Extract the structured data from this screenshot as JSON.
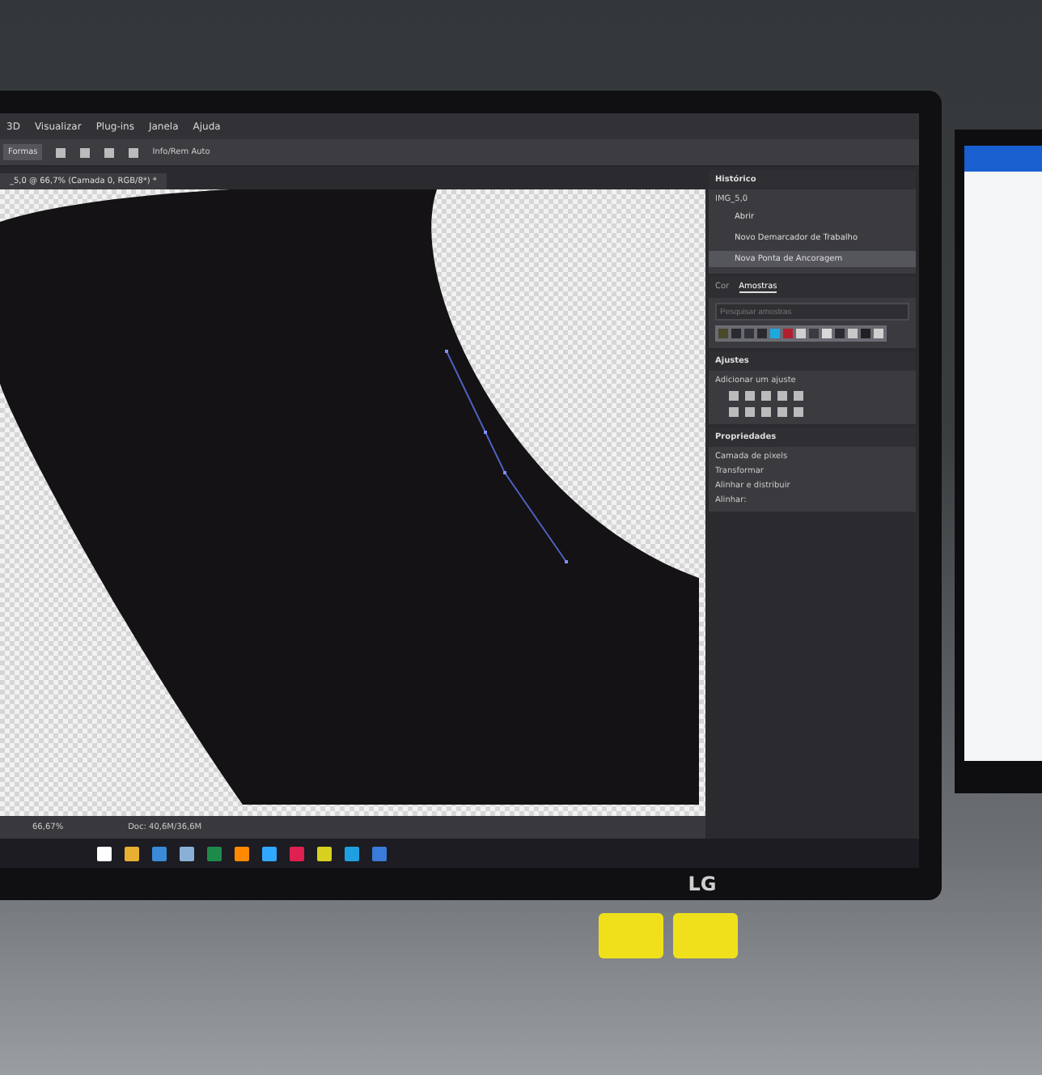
{
  "menu": [
    {
      "label": "3D"
    },
    {
      "label": "Visualizar"
    },
    {
      "label": "Plug-ins"
    },
    {
      "label": "Janela"
    },
    {
      "label": "Ajuda"
    }
  ],
  "options_bar": {
    "mode": "Formas",
    "auto_label": "Info/Rem Auto"
  },
  "document_tab": {
    "title": "_5,0 @ 66,7% (Camada 0, RGB/8*) *"
  },
  "history_panel": {
    "title": "Histórico",
    "snapshot": "IMG_5,0",
    "items": [
      {
        "label": "Abrir",
        "selected": false
      },
      {
        "label": "Novo Demarcador de Trabalho",
        "selected": false
      },
      {
        "label": "Nova Ponta de Ancoragem",
        "selected": true
      }
    ]
  },
  "swatches_panel": {
    "tabs": [
      {
        "label": "Cor",
        "selected": false
      },
      {
        "label": "Amostras",
        "selected": true
      }
    ],
    "search": {
      "placeholder": "Pesquisar amostras"
    },
    "swatches": [
      {
        "color": "#4a4a2a"
      },
      {
        "color": "#2a2a30"
      },
      {
        "color": "#33333a"
      },
      {
        "color": "#2a2a2e"
      },
      {
        "color": "#1ea8e0"
      },
      {
        "color": "#b02030"
      },
      {
        "color": "#d0d0d0"
      },
      {
        "color": "#3a3a40"
      },
      {
        "color": "#d8d8d8"
      },
      {
        "color": "#2a2a30"
      },
      {
        "color": "#c8c8c8"
      },
      {
        "color": "#202024"
      },
      {
        "color": "#d0d0d0"
      }
    ]
  },
  "adjustments_panel": {
    "title": "Ajustes",
    "hint": "Adicionar um ajuste"
  },
  "properties_panel": {
    "title": "Propriedades",
    "layer_type": "Camada de pixels",
    "transform_title": "Transformar",
    "align_title": "Alinhar e distribuir",
    "align_label": "Alinhar:"
  },
  "status_bar": {
    "zoom": "66,67%",
    "doc": "Doc: 40,6M/36,6M"
  },
  "monitor": {
    "brand": "LG"
  }
}
